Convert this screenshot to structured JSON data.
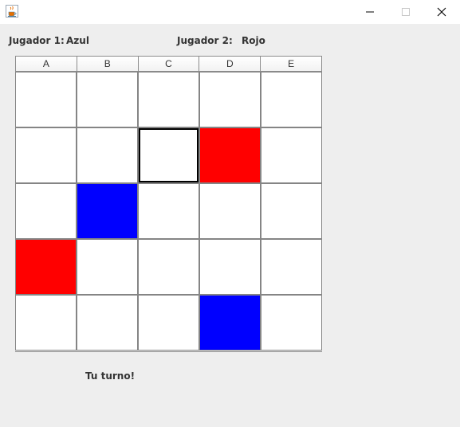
{
  "window": {
    "icon": "java-cup-icon",
    "controls": [
      "minimize-icon",
      "maximize-icon",
      "close-icon"
    ]
  },
  "players": {
    "p1_label": "Jugador 1:",
    "p1_value": "Azul",
    "p2_label": "Jugador 2:",
    "p2_value": "Rojo"
  },
  "board": {
    "columns": [
      "A",
      "B",
      "C",
      "D",
      "E"
    ],
    "rows": [
      [
        "empty",
        "empty",
        "empty",
        "empty",
        "empty"
      ],
      [
        "empty",
        "empty",
        "selected",
        "red",
        "empty"
      ],
      [
        "empty",
        "blue",
        "empty",
        "empty",
        "empty"
      ],
      [
        "red",
        "empty",
        "empty",
        "empty",
        "empty"
      ],
      [
        "empty",
        "empty",
        "empty",
        "blue",
        "empty"
      ]
    ],
    "colors": {
      "red": "#ff0000",
      "blue": "#0000ff",
      "empty": "#ffffff",
      "selected": "#ffffff"
    }
  },
  "status": "Tu turno!"
}
